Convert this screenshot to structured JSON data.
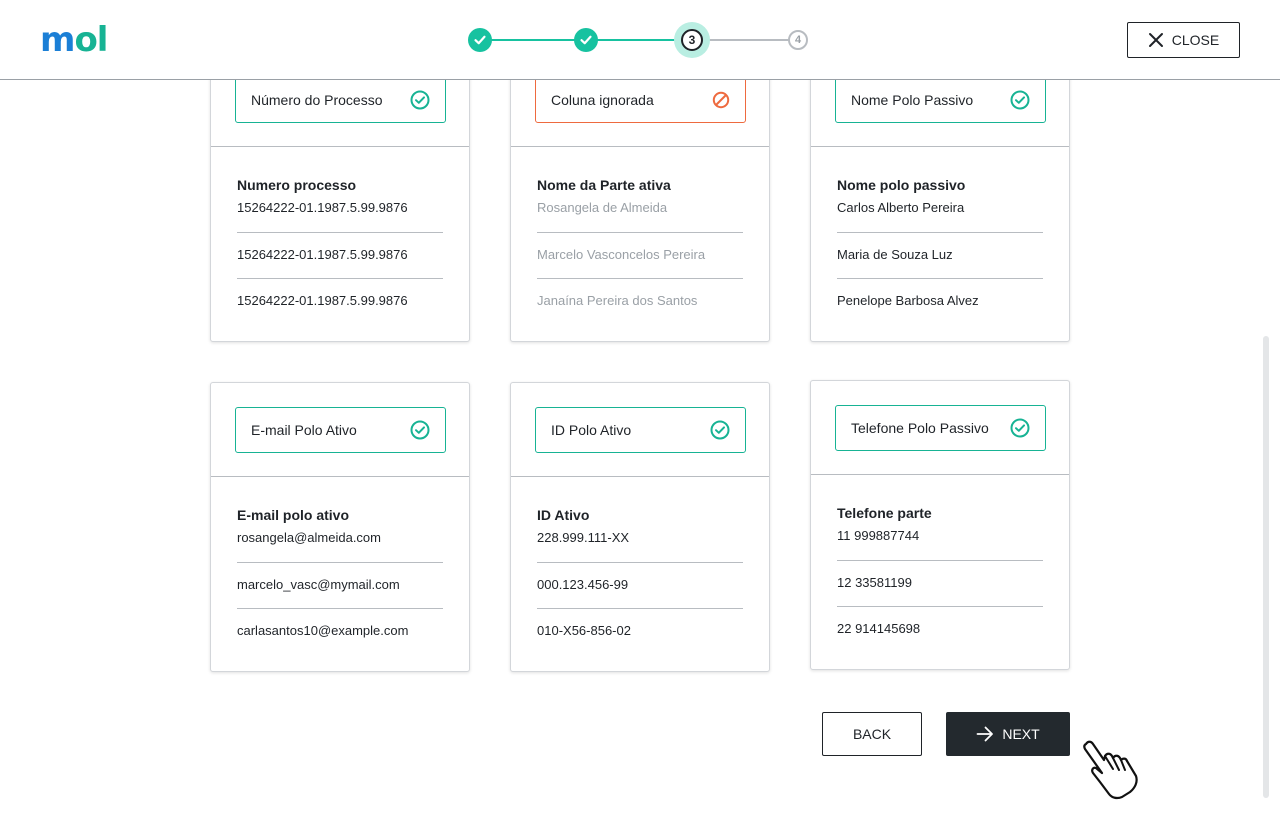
{
  "header": {
    "logo": {
      "part1": "m",
      "part2": "o",
      "part3": "l"
    },
    "close_label": "CLOSE",
    "stepper": {
      "steps": [
        {
          "state": "done",
          "label": ""
        },
        {
          "state": "done",
          "label": ""
        },
        {
          "state": "current",
          "label": "3"
        },
        {
          "state": "todo",
          "label": "4"
        }
      ]
    }
  },
  "cards": [
    {
      "mapping": "Número do Processo",
      "status": "matched",
      "column_title": "Numero processo",
      "rows": [
        "15264222-01.1987.5.99.9876",
        "15264222-01.1987.5.99.9876",
        "15264222-01.1987.5.99.9876"
      ]
    },
    {
      "mapping": "Coluna ignorada",
      "status": "ignored",
      "column_title": "Nome da Parte ativa",
      "rows": [
        "Rosangela de Almeida",
        "Marcelo Vasconcelos Pereira",
        "Janaína Pereira dos Santos"
      ]
    },
    {
      "mapping": "Nome Polo Passivo",
      "status": "matched",
      "column_title": "Nome polo passivo",
      "rows": [
        "Carlos Alberto Pereira",
        "Maria de Souza Luz",
        "Penelope Barbosa Alvez"
      ]
    },
    {
      "mapping": "E-mail Polo Ativo",
      "status": "matched",
      "column_title": "E-mail polo ativo",
      "rows": [
        "rosangela@almeida.com",
        "marcelo_vasc@mymail.com",
        "carlasantos10@example.com"
      ]
    },
    {
      "mapping": "ID Polo Ativo",
      "status": "matched",
      "column_title": "ID Ativo",
      "rows": [
        "228.999.111-XX",
        "000.123.456-99",
        "010-X56-856-02"
      ]
    },
    {
      "mapping": "Telefone Polo Passivo",
      "status": "matched",
      "column_title": "Telefone parte",
      "rows": [
        "11 999887744",
        "12 33581199",
        "22 914145698"
      ]
    }
  ],
  "footer": {
    "back_label": "BACK",
    "next_label": "NEXT"
  },
  "colors": {
    "accent_green": "#17c2a0",
    "matched_border": "#17b394",
    "ignored_orange": "#ee6a3f",
    "primary_dark": "#23292e",
    "logo_blue": "#1b7fd6"
  },
  "icons": {
    "matched": "check-circle-icon",
    "ignored": "ban-icon",
    "close": "close-icon",
    "next": "arrow-right-icon",
    "cursor": "hand-pointer-icon"
  }
}
